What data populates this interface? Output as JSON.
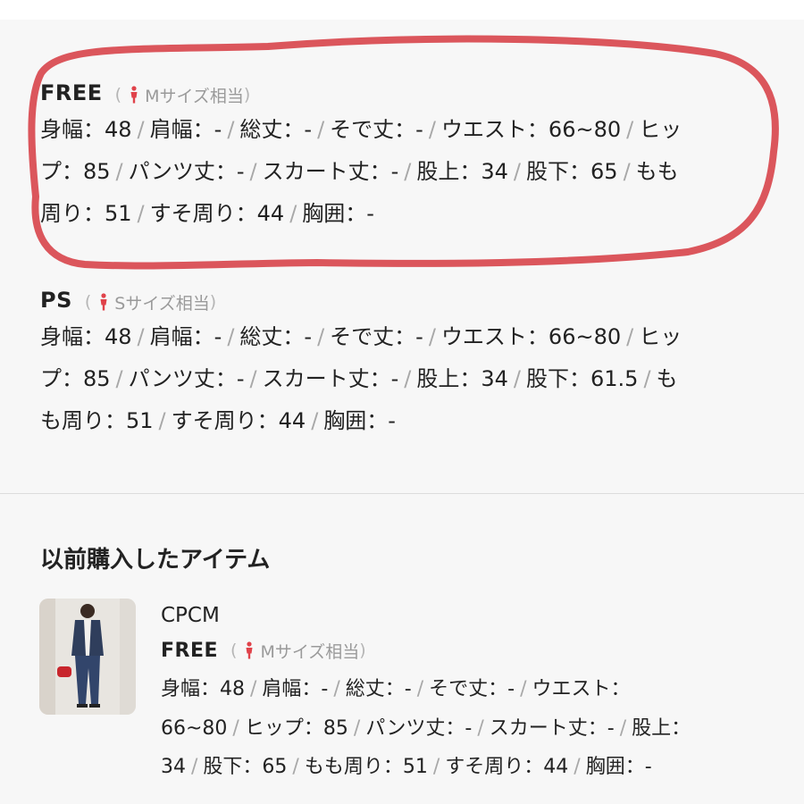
{
  "sizes": [
    {
      "name": "FREE",
      "open": "(",
      "equiv": "Mサイズ相当",
      "close": ")",
      "lines": [
        [
          "身幅：48",
          "肩幅：-",
          "総丈：-",
          "そで丈：-",
          "ウエスト：66~80",
          "ヒッ"
        ],
        [
          "プ：85",
          "パンツ丈：-",
          "スカート丈：-",
          "股上：34",
          "股下：65",
          "もも"
        ],
        [
          "周り：51",
          "すそ周り：44",
          "胸囲：-"
        ]
      ]
    },
    {
      "name": "PS",
      "open": "(",
      "equiv": "Sサイズ相当",
      "close": ")",
      "lines": [
        [
          "身幅：48",
          "肩幅：-",
          "総丈：-",
          "そで丈：-",
          "ウエスト：66~80",
          "ヒッ"
        ],
        [
          "プ：85",
          "パンツ丈：-",
          "スカート丈：-",
          "股上：34",
          "股下：61.5",
          "も"
        ],
        [
          "も周り：51",
          "すそ周り：44",
          "胸囲：-"
        ]
      ]
    }
  ],
  "previous": {
    "title": "以前購入したアイテム",
    "item": {
      "brand": "CPCM",
      "size_name": "FREE",
      "open": "(",
      "equiv": "Mサイズ相当",
      "close": ")",
      "lines": [
        [
          "身幅：48",
          "肩幅：-",
          "総丈：-",
          "そで丈：-",
          "ウエスト："
        ],
        [
          "66~80",
          "ヒップ：85",
          "パンツ丈：-",
          "スカート丈：-",
          "股上："
        ],
        [
          "34",
          "股下：65",
          "もも周り：51",
          "すそ周り：44",
          "胸囲：-"
        ]
      ]
    }
  },
  "colors": {
    "accent_red": "#e0424a",
    "annotation_ring": "#d8484e",
    "muted_text": "#9a9a9a"
  },
  "icons": {
    "person": "person-icon",
    "thumbnail": "product-photo"
  }
}
